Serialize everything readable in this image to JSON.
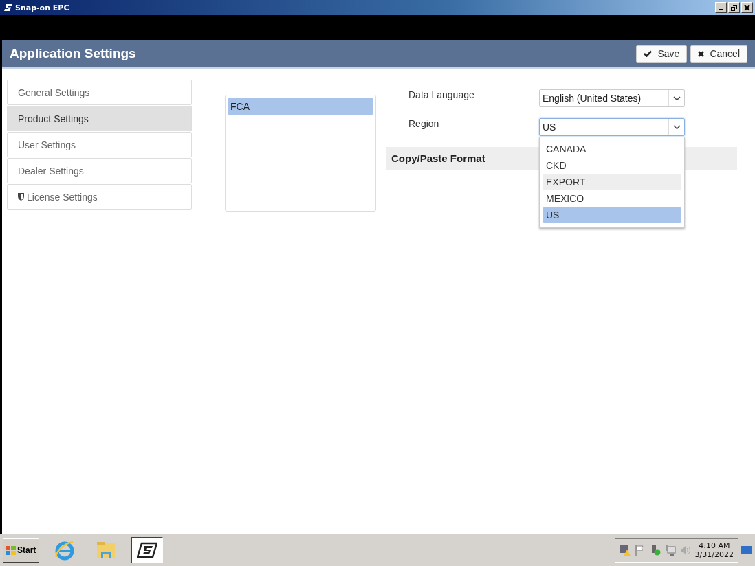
{
  "window": {
    "title": "Snap-on EPC"
  },
  "header": {
    "title": "Application Settings",
    "buttons": [
      {
        "kind": "save",
        "label": "Save"
      },
      {
        "kind": "cancel",
        "label": "Cancel"
      }
    ]
  },
  "sidebar": {
    "items": [
      {
        "label": "General Settings",
        "selected": false,
        "kind": "plain"
      },
      {
        "label": "Product Settings",
        "selected": true,
        "kind": "plain"
      },
      {
        "label": "User Settings",
        "selected": false,
        "kind": "plain"
      },
      {
        "label": "Dealer Settings",
        "selected": false,
        "kind": "plain"
      },
      {
        "label": "License Settings",
        "selected": false,
        "kind": "shield"
      }
    ]
  },
  "products": [
    {
      "label": "FCA",
      "selected": true
    }
  ],
  "fields": [
    {
      "label": "Data Language",
      "value": "English (United States)",
      "focused": false
    },
    {
      "label": "Region",
      "value": "US",
      "focused": true
    }
  ],
  "section": {
    "title": "Copy/Paste Format"
  },
  "region_dropdown": {
    "options": [
      {
        "label": "CANADA",
        "selected": false,
        "hovered": false
      },
      {
        "label": "CKD",
        "selected": false,
        "hovered": false
      },
      {
        "label": "EXPORT",
        "selected": false,
        "hovered": true
      },
      {
        "label": "MEXICO",
        "selected": false,
        "hovered": false
      },
      {
        "label": "US",
        "selected": true,
        "hovered": false
      }
    ]
  },
  "taskbar": {
    "start": "Start",
    "apps": [
      {
        "kind": "browser",
        "selected": false
      },
      {
        "kind": "folder",
        "selected": false
      },
      {
        "kind": "epc",
        "selected": true
      }
    ],
    "tray": [
      {
        "kind": "warning"
      },
      {
        "kind": "flag"
      },
      {
        "kind": "usb"
      },
      {
        "kind": "network"
      },
      {
        "kind": "volume"
      }
    ],
    "time": "4:10 AM",
    "date": "3/31/2022"
  }
}
